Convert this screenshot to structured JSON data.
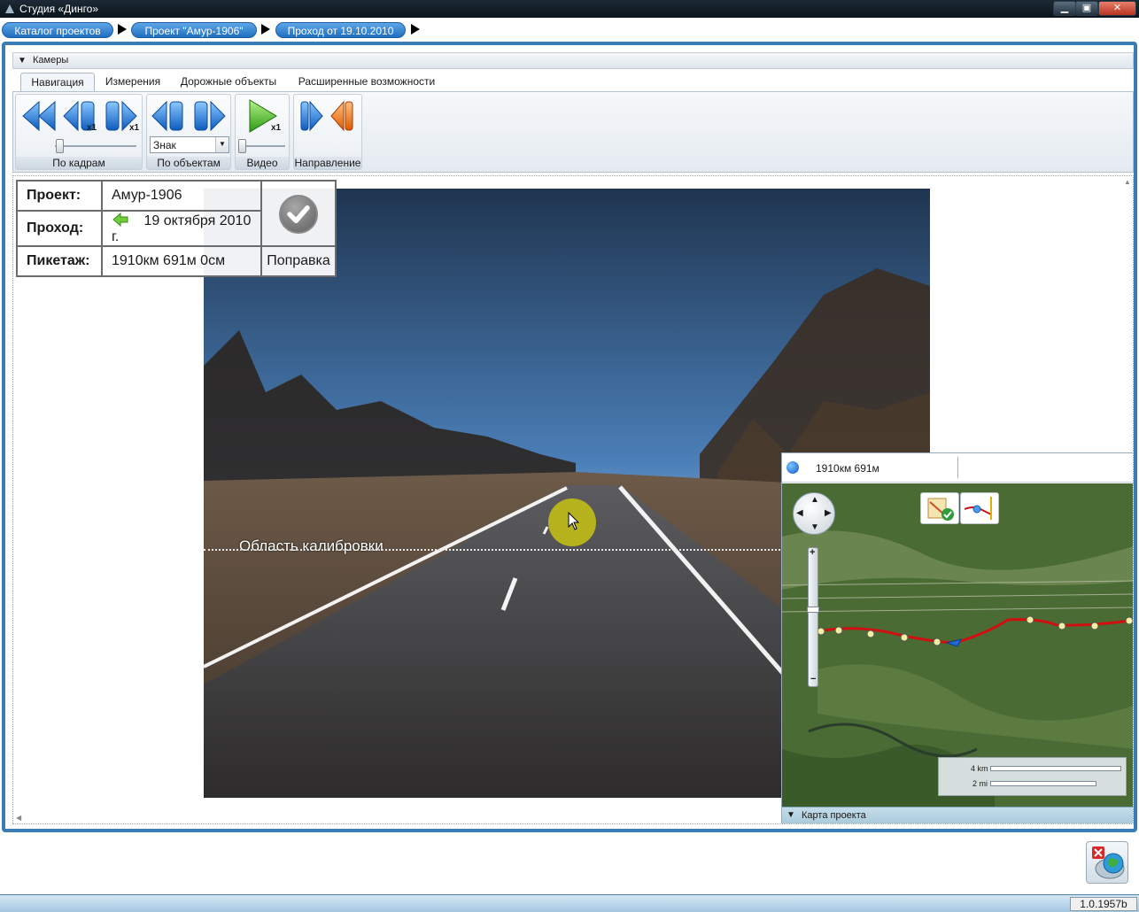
{
  "window": {
    "title": "Студия «Динго»",
    "min_icon": "minimize-icon",
    "max_icon": "maximize-icon",
    "close_icon": "close-icon"
  },
  "breadcrumb": {
    "items": [
      {
        "label": "Каталог проектов"
      },
      {
        "label": "Проект \"Амур-1906\""
      },
      {
        "label": "Проход от 19.10.2010"
      }
    ]
  },
  "cameras_panel": {
    "title": "Камеры"
  },
  "ribbon": {
    "tabs": [
      {
        "label": "Навигация",
        "active": true
      },
      {
        "label": "Измерения",
        "active": false
      },
      {
        "label": "Дорожные объекты",
        "active": false
      },
      {
        "label": "Расширенные возможности",
        "active": false
      }
    ],
    "groups": {
      "frames": {
        "label": "По кадрам",
        "step_badge_back": "x1",
        "step_badge_fwd": "x1"
      },
      "objects": {
        "label": "По объектам",
        "object_type": "Знак"
      },
      "video": {
        "label": "Видео",
        "speed_badge": "x1"
      },
      "direction": {
        "label": "Направление"
      }
    }
  },
  "info": {
    "project_label": "Проект:",
    "project_value": "Амур-1906",
    "pass_label": "Проход:",
    "pass_value": "19 октября 2010 г.",
    "picket_label": "Пикетаж:",
    "picket_value": "1910км 691м 0см",
    "correction_label": "Поправка"
  },
  "viewer": {
    "calibration_label": "Область калибровки"
  },
  "map": {
    "position_label": "1910км 691м",
    "footer_label": "Карта проекта",
    "scale_km": "4 km",
    "scale_mi": "2 mi"
  },
  "status": {
    "version": "1.0.1957b"
  },
  "colors": {
    "accent": "#3a7db5",
    "crumb": "#1f6fc0",
    "route": "#d01010"
  }
}
